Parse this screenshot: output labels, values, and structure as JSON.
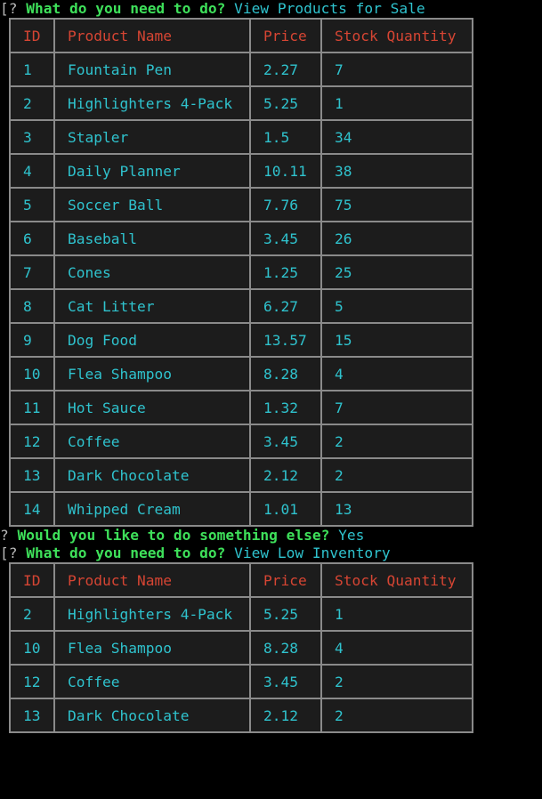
{
  "prompts": {
    "first": {
      "prefix": "[? ",
      "question": "What do you need to do?",
      "answer": "View Products for Sale"
    },
    "second": {
      "prefix": "? ",
      "question": "Would you like to do something else?",
      "answer": "Yes"
    },
    "third": {
      "prefix": "[? ",
      "question": "What do you need to do?",
      "answer": "View Low Inventory"
    }
  },
  "headers": [
    "ID",
    "Product Name",
    "Price",
    "Stock Quantity"
  ],
  "products_table": [
    [
      "1",
      "Fountain Pen",
      "2.27",
      "7"
    ],
    [
      "2",
      "Highlighters 4-Pack",
      "5.25",
      "1"
    ],
    [
      "3",
      "Stapler",
      "1.5",
      "34"
    ],
    [
      "4",
      "Daily Planner",
      "10.11",
      "38"
    ],
    [
      "5",
      "Soccer Ball",
      "7.76",
      "75"
    ],
    [
      "6",
      "Baseball",
      "3.45",
      "26"
    ],
    [
      "7",
      "Cones",
      "1.25",
      "25"
    ],
    [
      "8",
      "Cat Litter",
      "6.27",
      "5"
    ],
    [
      "9",
      "Dog Food",
      "13.57",
      "15"
    ],
    [
      "10",
      "Flea Shampoo",
      "8.28",
      "4"
    ],
    [
      "11",
      "Hot Sauce",
      "1.32",
      "7"
    ],
    [
      "12",
      "Coffee",
      "3.45",
      "2"
    ],
    [
      "13",
      "Dark Chocolate",
      "2.12",
      "2"
    ],
    [
      "14",
      "Whipped Cream",
      "1.01",
      "13"
    ]
  ],
  "low_inventory_table": [
    [
      "2",
      "Highlighters 4-Pack",
      "5.25",
      "1"
    ],
    [
      "10",
      "Flea Shampoo",
      "8.28",
      "4"
    ],
    [
      "12",
      "Coffee",
      "3.45",
      "2"
    ],
    [
      "13",
      "Dark Chocolate",
      "2.12",
      "2"
    ]
  ],
  "colors": {
    "background": "#000000",
    "question": "#3ee05a",
    "answer": "#2fc3ce",
    "header": "#d64533",
    "border": "#8a8a8a"
  }
}
